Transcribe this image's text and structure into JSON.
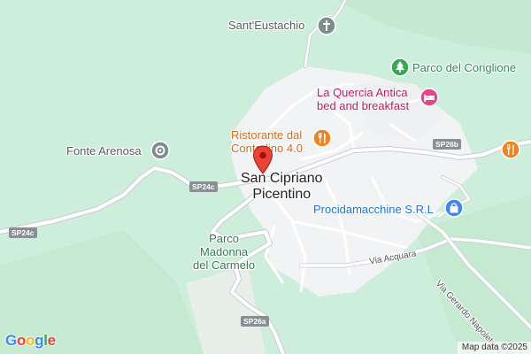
{
  "map": {
    "background_color": "#cdeeda",
    "urban_color": "#f1f3f4",
    "road_color": "#ffffff",
    "road_outline_color": "#c9ccd1"
  },
  "places": {
    "town_line1": "San Cipriano",
    "town_line2": "Picentino",
    "santeustachio": "Sant'Eustachio",
    "fonte_arenosa": "Fonte Arenosa",
    "parco_coriglione": "Parco del Coriglione",
    "quercia_line1": "La Quercia Antica",
    "quercia_line2": "bed and breakfast",
    "ristorante_line1": "Ristorante dal",
    "ristorante_line2": "Contadino 4.0",
    "procida": "Procidamacchine S.R.L",
    "parco_madonna_line1": "Parco",
    "parco_madonna_line2": "Madonna",
    "parco_madonna_line3": "del Carmelo"
  },
  "roads": {
    "sp24c_a": "SP24c",
    "sp24c_b": "SP24c",
    "sp26b": "SP26b",
    "sp26a": "SP26a",
    "via_acquara": "Via Acquara",
    "via_gerardo": "Via Gerardo Napoletano"
  },
  "icons": {
    "pin": "red-location-pin-icon",
    "church": "church-cross-icon",
    "landmark": "gray-landmark-icon",
    "park": "tree-park-icon",
    "hotel": "bed-hotel-icon",
    "restaurant": "fork-knife-restaurant-icon",
    "shop": "shopping-bag-icon"
  },
  "brand": {
    "logo_text": "Google",
    "attribution": "Map data ©2025"
  }
}
